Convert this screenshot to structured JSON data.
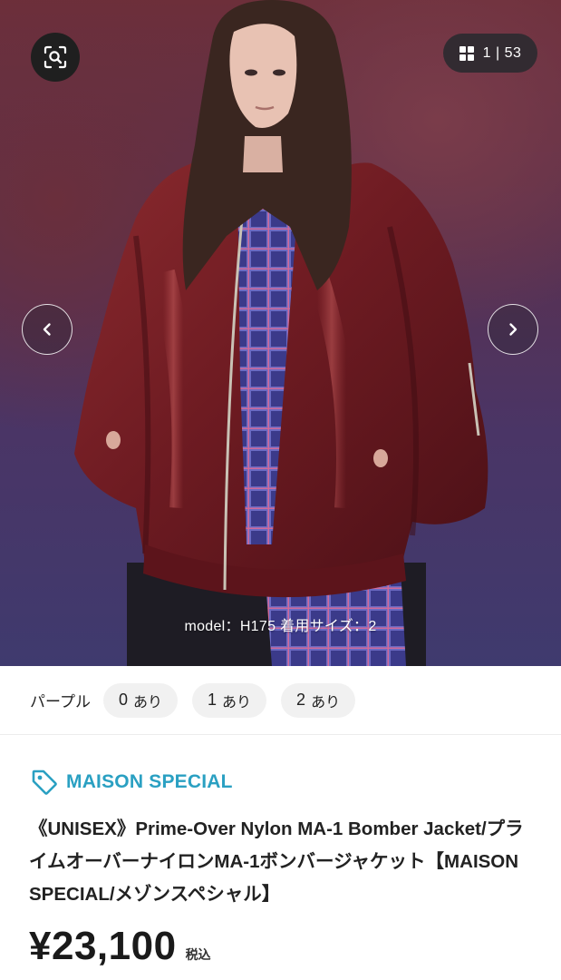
{
  "gallery": {
    "counter": "1 | 53",
    "caption": "model：H175 着用サイズ：2"
  },
  "variants": {
    "color": "パープル",
    "sizes": [
      {
        "size": "0",
        "stock": "あり"
      },
      {
        "size": "1",
        "stock": "あり"
      },
      {
        "size": "2",
        "stock": "あり"
      }
    ]
  },
  "product": {
    "brand": "MAISON SPECIAL",
    "title": "《UNISEX》Prime-Over Nylon MA-1 Bomber Jacket/プライムオーバーナイロンMA-1ボンバージャケット【MAISON SPECIAL/メゾンスペシャル】",
    "price": "¥23,100",
    "tax_label": "税込"
  },
  "colors": {
    "brand_accent": "#2aa0c2",
    "chip_background": "#f1f1f1",
    "overlay_dark": "#1f1f1f"
  },
  "icons": {
    "zoom": "image-search-icon",
    "grid": "grid-icon",
    "prev": "chevron-left-icon",
    "next": "chevron-right-icon",
    "brand": "tag-icon"
  }
}
